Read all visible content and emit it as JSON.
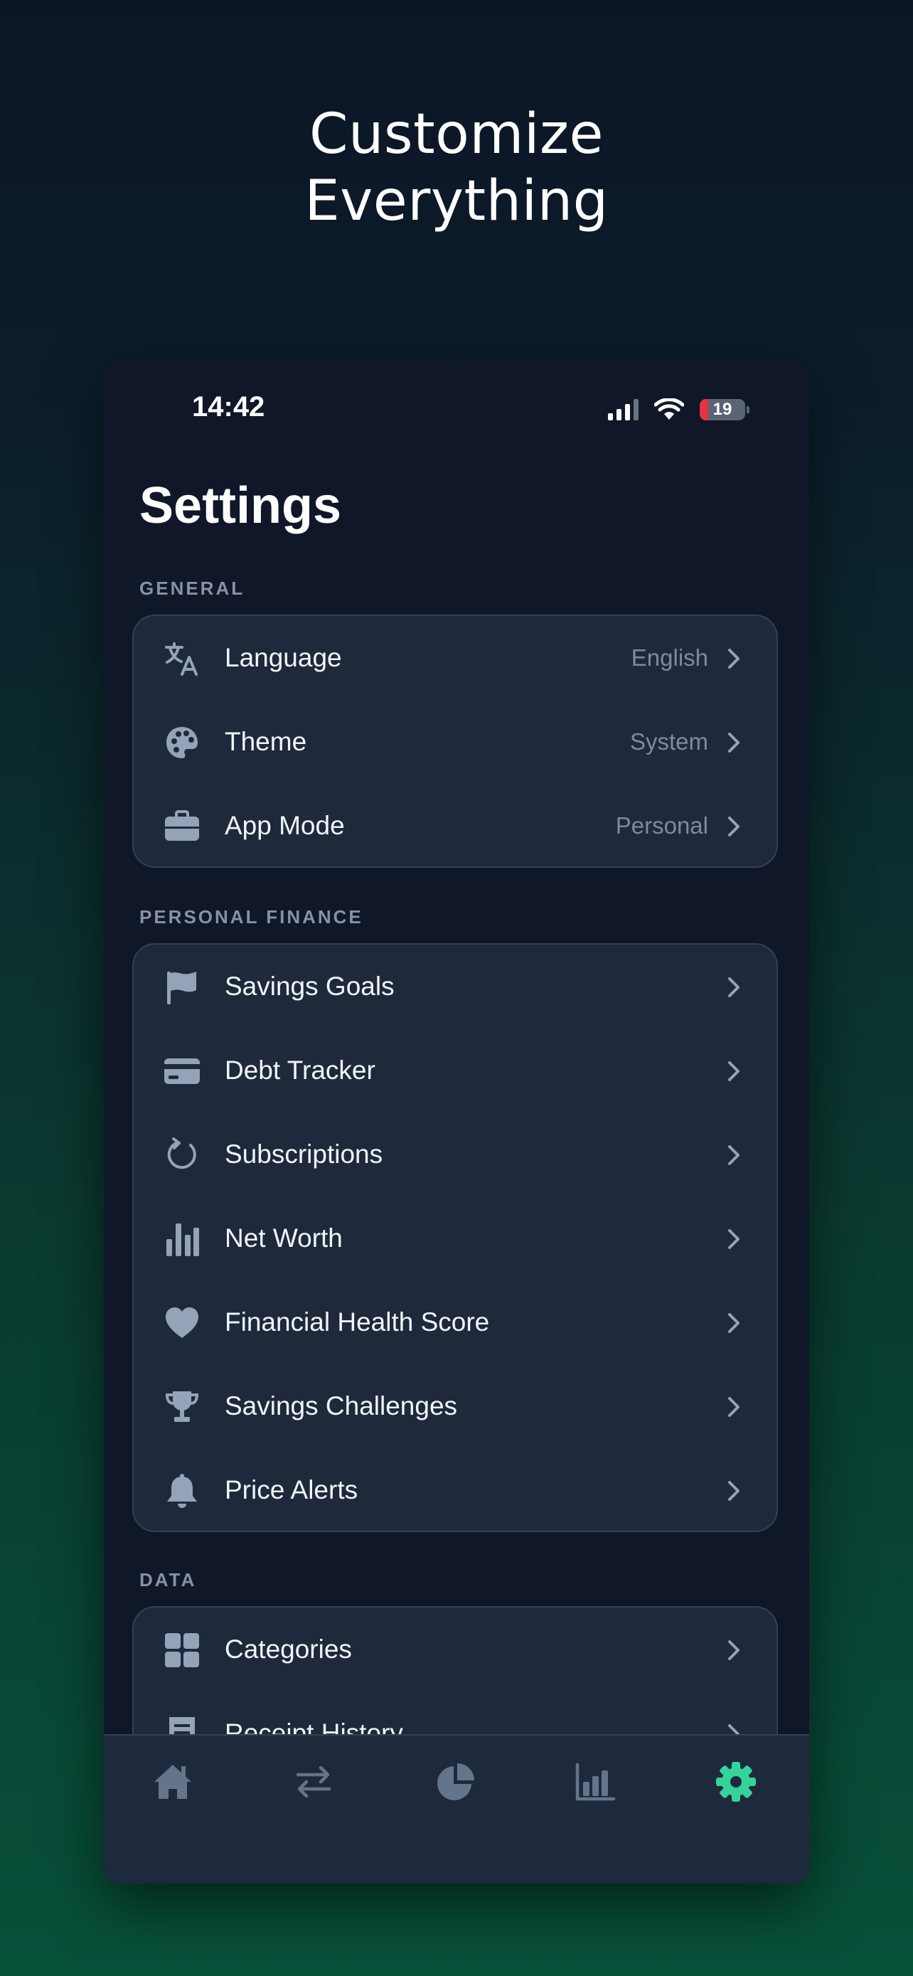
{
  "headline": {
    "line1": "Customize",
    "line2": "Everything"
  },
  "status_bar": {
    "time": "14:42",
    "battery": "19",
    "battery_level": 0.19
  },
  "page_title": "Settings",
  "sections": [
    {
      "label": "GENERAL",
      "items": [
        {
          "icon": "translate-icon",
          "label": "Language",
          "value": "English"
        },
        {
          "icon": "palette-icon",
          "label": "Theme",
          "value": "System"
        },
        {
          "icon": "briefcase-icon",
          "label": "App Mode",
          "value": "Personal"
        }
      ]
    },
    {
      "label": "PERSONAL FINANCE",
      "items": [
        {
          "icon": "flag-icon",
          "label": "Savings Goals"
        },
        {
          "icon": "credit-card-icon",
          "label": "Debt Tracker"
        },
        {
          "icon": "refresh-icon",
          "label": "Subscriptions"
        },
        {
          "icon": "bar-chart-icon",
          "label": "Net Worth"
        },
        {
          "icon": "heart-icon",
          "label": "Financial Health Score"
        },
        {
          "icon": "trophy-icon",
          "label": "Savings Challenges"
        },
        {
          "icon": "bell-icon",
          "label": "Price Alerts"
        }
      ]
    },
    {
      "label": "DATA",
      "items": [
        {
          "icon": "grid-icon",
          "label": "Categories"
        },
        {
          "icon": "receipt-icon",
          "label": "Receipt History"
        }
      ]
    }
  ],
  "tab_bar": {
    "tabs": [
      {
        "icon": "home-icon",
        "active": false
      },
      {
        "icon": "transfer-arrows-icon",
        "active": false
      },
      {
        "icon": "pie-chart-icon",
        "active": false
      },
      {
        "icon": "bar-chart-icon",
        "active": false
      },
      {
        "icon": "gear-icon",
        "active": true
      }
    ]
  },
  "colors": {
    "background_top": "#0b1526",
    "background_bottom": "#07503a",
    "card": "#1e293b",
    "icon": "#94a3b8",
    "active_tab": "#34d399",
    "battery_low": "#e5333f"
  }
}
